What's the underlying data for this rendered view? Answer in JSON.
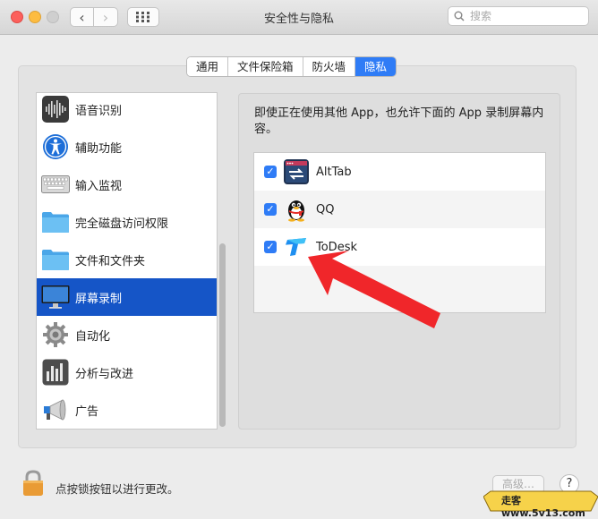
{
  "window": {
    "title": "安全性与隐私"
  },
  "search": {
    "placeholder": "搜索"
  },
  "tabs": [
    {
      "label": "通用",
      "active": false
    },
    {
      "label": "文件保险箱",
      "active": false
    },
    {
      "label": "防火墙",
      "active": false
    },
    {
      "label": "隐私",
      "active": true
    }
  ],
  "sidebar": {
    "items": [
      {
        "label": "语音识别",
        "icon": "waveform-icon"
      },
      {
        "label": "辅助功能",
        "icon": "accessibility-icon"
      },
      {
        "label": "输入监视",
        "icon": "keyboard-icon"
      },
      {
        "label": "完全磁盘访问权限",
        "icon": "folder-icon"
      },
      {
        "label": "文件和文件夹",
        "icon": "folder-icon"
      },
      {
        "label": "屏幕录制",
        "icon": "display-icon",
        "active": true
      },
      {
        "label": "自动化",
        "icon": "gear-icon"
      },
      {
        "label": "分析与改进",
        "icon": "bar-chart-icon"
      },
      {
        "label": "广告",
        "icon": "megaphone-icon"
      }
    ]
  },
  "panel": {
    "description": "即使正在使用其他 App，也允许下面的 App 录制屏幕内容。",
    "apps": [
      {
        "name": "AltTab",
        "checked": true,
        "icon": "alttab-icon"
      },
      {
        "name": "QQ",
        "checked": true,
        "icon": "qq-penguin-icon"
      },
      {
        "name": "ToDesk",
        "checked": true,
        "icon": "todesk-icon"
      }
    ]
  },
  "footer": {
    "lock_text": "点按锁按钮以进行更改。",
    "advanced_label": "高级…",
    "help_label": "?"
  },
  "watermark": {
    "text": "走客 www.5v13.com"
  },
  "colors": {
    "accent": "#2f7cf6",
    "selection": "#1555c7",
    "arrow": "#f0262a"
  }
}
